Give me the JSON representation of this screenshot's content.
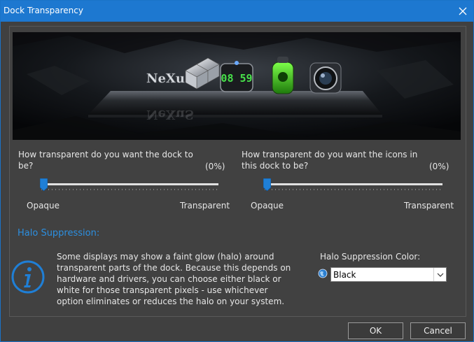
{
  "window": {
    "title": "Dock Transparency"
  },
  "preview": {
    "clock_time": "08 59",
    "logo_text": "NeXuS"
  },
  "dock_slider": {
    "question": "How transparent do you want the dock to be?",
    "value": "(0%)",
    "level": 0,
    "min_label": "Opaque",
    "max_label": "Transparent"
  },
  "icons_slider": {
    "question": "How transparent do you want the icons in this dock to be?",
    "value": "(0%)",
    "level": 0,
    "min_label": "Opaque",
    "max_label": "Transparent"
  },
  "halo": {
    "heading": "Halo Suppression:",
    "description": "Some displays may show a faint glow (halo) around transparent parts of the dock. Because this depends on hardware and drivers, you can choose either black or white for those transparent pixels  - use whichever option eliminates or reduces the halo on your system.",
    "color_label": "Halo Suppression Color:",
    "color_value": "Black",
    "icon": "info-icon"
  },
  "buttons": {
    "ok": "OK",
    "cancel": "Cancel"
  },
  "colors": {
    "titlebar": "#1d78d0",
    "accent": "#2c8fe0",
    "background": "#404040"
  }
}
